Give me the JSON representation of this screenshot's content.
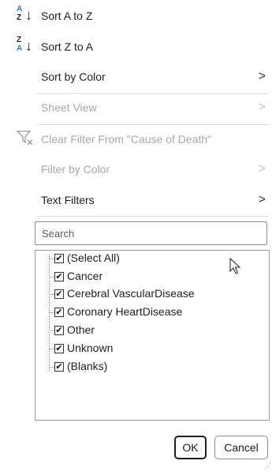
{
  "menu": {
    "sort_a_z": "Sort A to Z",
    "sort_z_a": "Sort Z to A",
    "sort_by_color": "Sort by Color",
    "sheet_view": "Sheet View",
    "clear_filter": "Clear Filter From \"Cause of Death\"",
    "filter_by_color": "Filter by Color",
    "text_filters": "Text Filters",
    "submenu_arrow": ">"
  },
  "sort_icon": {
    "a": "A",
    "z": "Z",
    "arrow": "↓"
  },
  "search": {
    "placeholder": "Search"
  },
  "filter_list": {
    "items": [
      {
        "label": "(Select All)",
        "checked": true
      },
      {
        "label": "Cancer",
        "checked": true
      },
      {
        "label": "Cerebral VascularDisease",
        "checked": true
      },
      {
        "label": "Coronary HeartDisease",
        "checked": true
      },
      {
        "label": "Other",
        "checked": true
      },
      {
        "label": "Unknown",
        "checked": true
      },
      {
        "label": "(Blanks)",
        "checked": true
      }
    ],
    "check_glyph": "✔"
  },
  "buttons": {
    "ok": "OK",
    "cancel": "Cancel"
  },
  "colors": {
    "disabled_text": "#a8a8a8",
    "sort_icon_blue": "#3a73c4",
    "border": "#8f8f8f"
  }
}
